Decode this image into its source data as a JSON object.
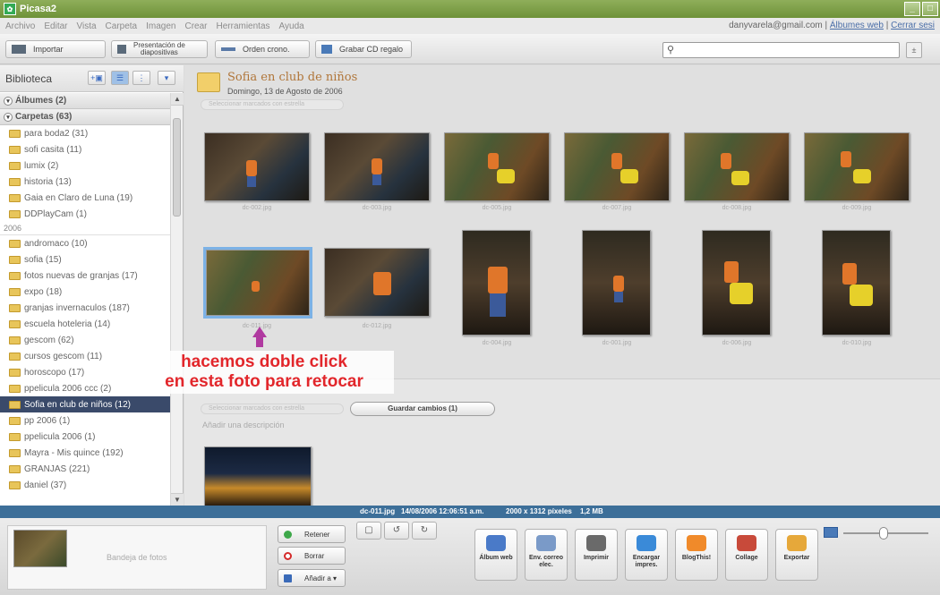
{
  "window": {
    "title": "Picasa2"
  },
  "menu": {
    "items": [
      "Archivo",
      "Editar",
      "Vista",
      "Carpeta",
      "Imagen",
      "Crear",
      "Herramientas",
      "Ayuda"
    ],
    "account_email": "danyvarela@gmail.com",
    "link_albums": "Álbumes web",
    "link_logout": "Cerrar sesi",
    "sep": "|"
  },
  "toolbar": {
    "import": "Importar",
    "slideshow_l1": "Presentación de",
    "slideshow_l2": "diapositivas",
    "timeline": "Orden crono.",
    "burn": "Grabar CD regalo"
  },
  "sidebar": {
    "title": "Biblioteca",
    "albums_header": "Álbumes (2)",
    "folders_header": "Carpetas (63)",
    "items_a": [
      "para boda2 (31)",
      "sofi casita (11)",
      "lumix (2)",
      "historia (13)",
      "Gaia en Claro de Luna (19)",
      "DDPlayCam (1)"
    ],
    "year": "2006",
    "items_b": [
      "andromaco (10)",
      "sofia (15)",
      "fotos nuevas de granjas (17)",
      "expo (18)",
      "granjas invernaculos (187)",
      "escuela hoteleria (14)",
      "gescom (62)",
      "cursos gescom (11)",
      "horoscopo (17)",
      "ppelicula 2006 ccc (2)",
      "Sofia en club de niños (12)",
      "pp 2006 (1)",
      "ppelicula 2006 (1)",
      "Mayra - Mis quince (192)",
      "GRANJAS (221)",
      "daniel (37)"
    ],
    "selected": "Sofia en club de niños (12)"
  },
  "album": {
    "title": "Sofia en club de niños",
    "date": "Domingo, 13 de Agosto de 2006",
    "select_all": "Seleccionar marcados con estrella",
    "captions_row1": [
      "dc-002.jpg",
      "dc-003.jpg",
      "dc-005.jpg",
      "dc-007.jpg",
      "dc-008.jpg",
      "dc-009.jpg"
    ],
    "captions_row2": [
      "dc-011.jpg",
      "dc-012.jpg",
      "dc-004.jpg",
      "dc-001.jpg",
      "dc-006.jpg",
      "dc-010.jpg"
    ]
  },
  "annotation": {
    "line1": "hacemos doble click",
    "line2": "en esta foto para retocar"
  },
  "section2": {
    "select_all": "Seleccionar marcados con estrella",
    "save_changes": "Guardar cambios (1)",
    "add_desc": "Añadir una descripción"
  },
  "status": {
    "file": "dc-011.jpg",
    "datetime": "14/08/2006 12:06:51 a.m.",
    "dimensions": "2000 x 1312 píxeles",
    "size": "1,2 MB"
  },
  "bottom": {
    "tray_label": "Bandeja de fotos",
    "hold": "Retener",
    "clear": "Borrar",
    "add_to": "Añadir a ▾",
    "actions": [
      {
        "l1": "Álbum web",
        "l2": "",
        "color": "#4a7ac8"
      },
      {
        "l1": "Env. correo",
        "l2": "elec.",
        "color": "#7a9ac8"
      },
      {
        "l1": "Imprimir",
        "l2": "",
        "color": "#6a6a6a"
      },
      {
        "l1": "Encargar",
        "l2": "impres.",
        "color": "#3a8ad8"
      },
      {
        "l1": "BlogThis!",
        "l2": "",
        "color": "#f08a2a"
      },
      {
        "l1": "Collage",
        "l2": "",
        "color": "#c84a3a"
      },
      {
        "l1": "Exportar",
        "l2": "",
        "color": "#e6a83a"
      }
    ]
  }
}
